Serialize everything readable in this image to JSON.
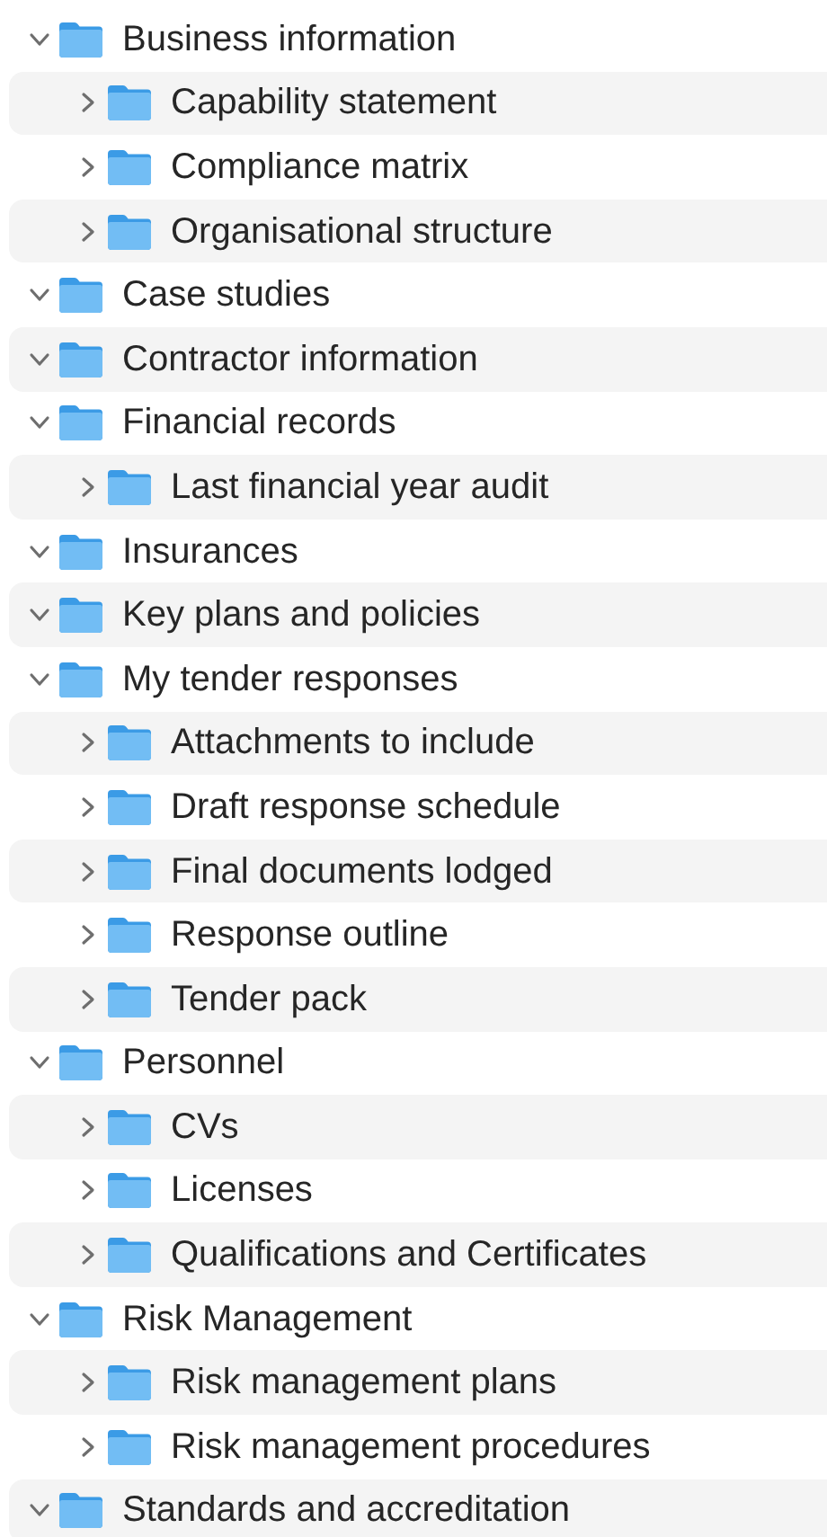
{
  "folders": [
    {
      "name": "Business information",
      "expanded": true,
      "children": [
        {
          "name": "Capability statement",
          "expanded": false
        },
        {
          "name": "Compliance matrix",
          "expanded": false
        },
        {
          "name": "Organisational structure",
          "expanded": false
        }
      ]
    },
    {
      "name": "Case studies",
      "expanded": true
    },
    {
      "name": "Contractor information",
      "expanded": true
    },
    {
      "name": "Financial records",
      "expanded": true,
      "children": [
        {
          "name": "Last financial year audit",
          "expanded": false
        }
      ]
    },
    {
      "name": "Insurances",
      "expanded": true
    },
    {
      "name": "Key plans and policies",
      "expanded": true
    },
    {
      "name": "My tender responses",
      "expanded": true,
      "children": [
        {
          "name": "Attachments to include",
          "expanded": false
        },
        {
          "name": "Draft response schedule",
          "expanded": false
        },
        {
          "name": "Final documents lodged",
          "expanded": false
        },
        {
          "name": "Response outline",
          "expanded": false
        },
        {
          "name": "Tender pack",
          "expanded": false
        }
      ]
    },
    {
      "name": "Personnel",
      "expanded": true,
      "children": [
        {
          "name": "CVs",
          "expanded": false
        },
        {
          "name": "Licenses",
          "expanded": false
        },
        {
          "name": "Qualifications and Certificates",
          "expanded": false
        }
      ]
    },
    {
      "name": "Risk Management",
      "expanded": true,
      "children": [
        {
          "name": "Risk management plans",
          "expanded": false
        },
        {
          "name": "Risk management procedures",
          "expanded": false
        }
      ]
    },
    {
      "name": "Standards and accreditation",
      "expanded": true
    }
  ]
}
